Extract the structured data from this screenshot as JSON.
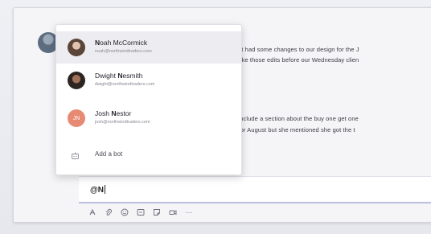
{
  "messages": [
    "lant had some changes to our design for the J",
    "make those edits before our Wednesday clien",
    "o include a section about the buy one get one",
    "d for August but she mentioned she got the t"
  ],
  "mention_popup": {
    "suggestions": [
      {
        "name_pre": "N",
        "name_post": "oah McCormick",
        "email": "noah@northwindtraders.com",
        "initials": "",
        "selected": true
      },
      {
        "name_pre": "Dwight ",
        "name_bold": "N",
        "name_post": "esmith",
        "email": "dwight@northwindtraders.com",
        "initials": "",
        "selected": false
      },
      {
        "name_pre": "Josh ",
        "name_bold": "N",
        "name_post": "estor",
        "email": "josh@northwindtraders.com",
        "initials": "JN",
        "selected": false
      }
    ],
    "add_bot_label": "Add a bot"
  },
  "compose": {
    "text": "@N"
  },
  "toolbar": {
    "icons": [
      "format-icon",
      "attach-icon",
      "emoji-icon",
      "gif-icon",
      "sticker-icon",
      "meet-icon",
      "more-icon"
    ],
    "more_label": "···"
  }
}
